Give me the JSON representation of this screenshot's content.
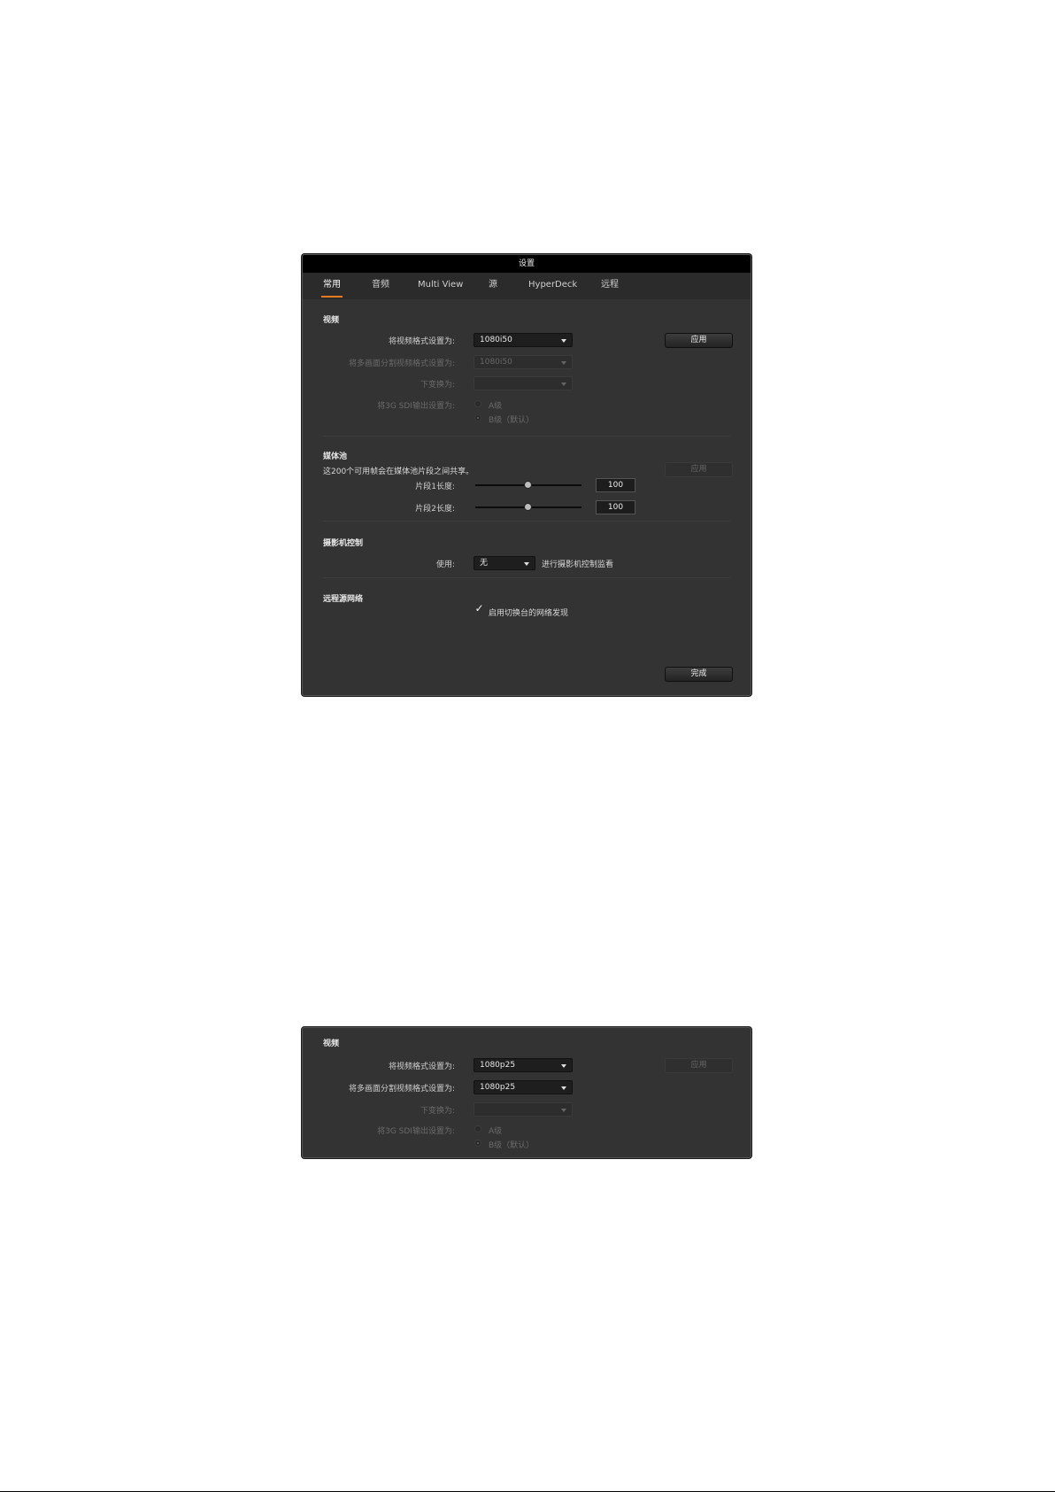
{
  "window1": {
    "title": "设置",
    "tabs": [
      "常用",
      "音频",
      "Multi View",
      "源",
      "HyperDeck",
      "远程"
    ],
    "video": {
      "section_title": "视频",
      "format_label": "将视频格式设置为:",
      "format_value": "1080i50",
      "multiview_label": "将多画面分割视频格式设置为:",
      "multiview_value": "1080i50",
      "downconvert_label": "下变换为:",
      "downconvert_value": "",
      "sdi3g_label": "将3G SDI输出设置为:",
      "level_a": "A级",
      "level_b": "B级（默认）",
      "apply": "应用"
    },
    "media_pool": {
      "section_title": "媒体池",
      "description": "这200个可用帧会在媒体池片段之间共享。",
      "clip1_label": "片段1长度:",
      "clip1_value": "100",
      "clip2_label": "片段2长度:",
      "clip2_value": "100",
      "apply": "应用"
    },
    "camera_control": {
      "section_title": "摄影机控制",
      "use_label": "使用:",
      "use_value": "无",
      "use_suffix": "进行摄影机控制监看"
    },
    "remote_source": {
      "section_title": "远程源网络",
      "checkbox_label": "启用切换台的网络发现",
      "checked": true
    },
    "done": "完成"
  },
  "window2": {
    "video": {
      "section_title": "视频",
      "format_label": "将视频格式设置为:",
      "format_value": "1080p25",
      "multiview_label": "将多画面分割视频格式设置为:",
      "multiview_value": "1080p25",
      "downconvert_label": "下变换为:",
      "downconvert_value": "",
      "sdi3g_label": "将3G SDI输出设置为:",
      "level_a": "A级",
      "level_b": "B级（默认）",
      "apply": "应用"
    }
  },
  "colors": {
    "accent": "#e67a1e",
    "window_bg": "#333333",
    "titlebar_bg": "#000000"
  }
}
